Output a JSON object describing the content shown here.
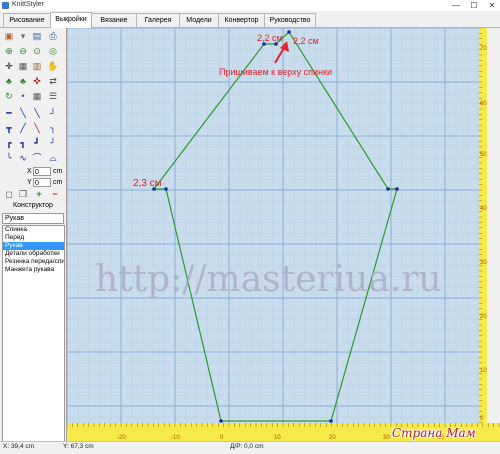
{
  "window": {
    "title": "KnittStyler",
    "minimize": "—",
    "maximize": "☐",
    "close": "✕"
  },
  "tabs": [
    "Рисование",
    "Выкройки",
    "Вязание",
    "Галерея",
    "Модели",
    "Конвертор",
    "Руководство"
  ],
  "active_tab": 1,
  "fields": {
    "x_label": "X",
    "x_value": "0",
    "y_label": "Y",
    "y_value": "0",
    "unit": "cm"
  },
  "constructor": {
    "title": "Конструктор",
    "selected": "Рукав"
  },
  "pattern_list": [
    "Спинка",
    "Перед",
    "Рукав",
    "Детали обработки",
    "Резинка переда/спин",
    "Манжета рукава"
  ],
  "selected_index": 2,
  "annotations": {
    "dim_left": "2,3 см",
    "dim_top_1": "2,2 см",
    "dim_top_2": "2,2 см",
    "note": "Пришиваем к верху спинки"
  },
  "watermark": "http://masteriua.ru",
  "logo": "Страна Мам",
  "ruler_top_labels": [
    "-20",
    "-10",
    "0",
    "10",
    "20",
    "30",
    "40"
  ],
  "ruler_right_labels": [
    "70",
    "60",
    "50",
    "40",
    "30",
    "20",
    "10",
    "0"
  ],
  "status": {
    "x": "X: 39,4 cm",
    "y": "Y: 67,3 cm",
    "length": "Д/Р: 0,0 cm"
  },
  "colors": {
    "canvas_bg": "#c9dceb",
    "grid": "#9ab8e6",
    "pattern_line": "#2e9a2e",
    "vertex": "#1a2aa8",
    "annotation": "#e8222c",
    "ruler": "#f7e94a"
  }
}
